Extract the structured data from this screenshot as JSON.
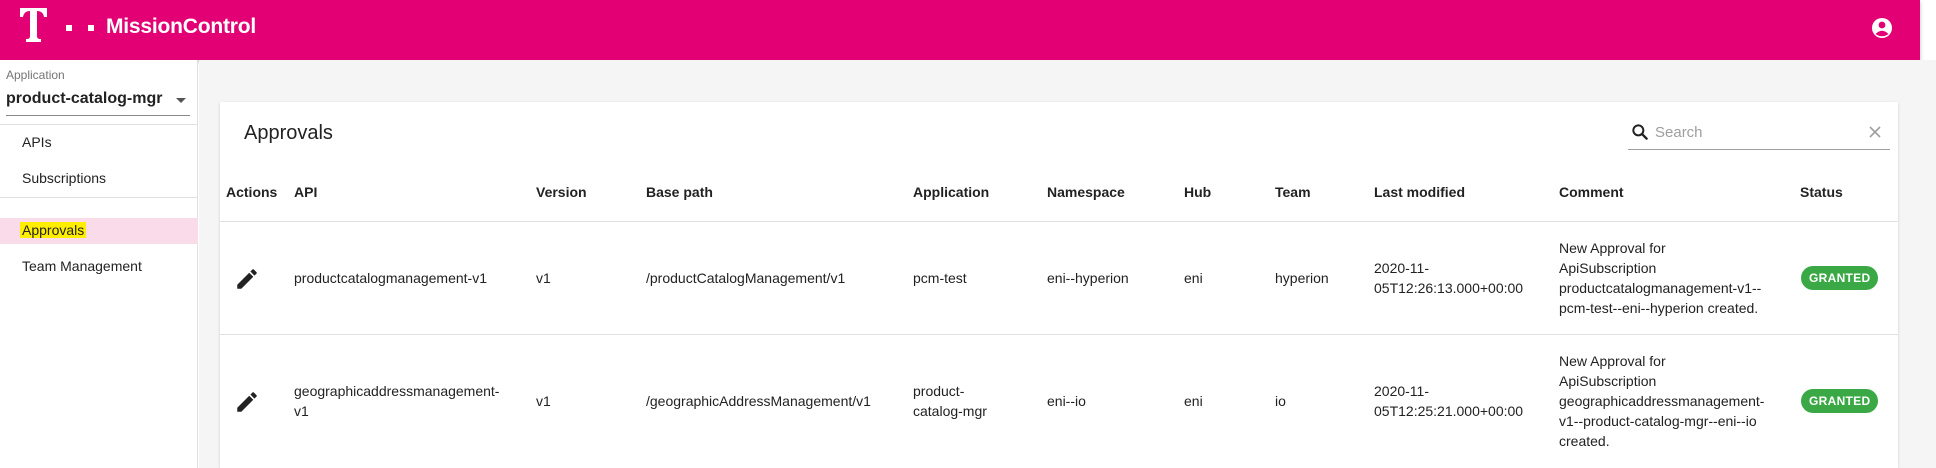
{
  "header": {
    "app_title": "MissionControl",
    "brand_color": "#e20074",
    "logo_icon": "telekom-t-logo",
    "account_icon": "account-circle-icon"
  },
  "sidebar": {
    "application_label": "Application",
    "application_value": "product-catalog-mgr",
    "items": [
      {
        "label": "APIs"
      },
      {
        "label": "Subscriptions"
      },
      {
        "label": "Approvals",
        "active": true
      },
      {
        "label": "Team Management"
      }
    ]
  },
  "approvals": {
    "title": "Approvals",
    "search_placeholder": "Search",
    "columns": {
      "actions": "Actions",
      "api": "API",
      "version": "Version",
      "base_path": "Base path",
      "application": "Application",
      "namespace": "Namespace",
      "hub": "Hub",
      "team": "Team",
      "last_modified": "Last modified",
      "comment": "Comment",
      "status": "Status"
    },
    "rows": [
      {
        "api": [
          "productcatalogmanagement-v1"
        ],
        "version": "v1",
        "base_path": "/productCatalogManagement/v1",
        "application": [
          "pcm-test"
        ],
        "namespace": "eni--hyperion",
        "hub": "eni",
        "team": "hyperion",
        "last_modified": [
          "2020-11-",
          "05T12:26:13.000+00:00"
        ],
        "comment": [
          "New Approval for",
          "ApiSubscription",
          "productcatalogmanagement-v1--",
          "pcm-test--eni--hyperion created."
        ],
        "status": "GRANTED"
      },
      {
        "api": [
          "geographicaddressmanagement-",
          "v1"
        ],
        "version": "v1",
        "base_path": "/geographicAddressManagement/v1",
        "application": [
          "product-",
          "catalog-mgr"
        ],
        "namespace": "eni--io",
        "hub": "eni",
        "team": "io",
        "last_modified": [
          "2020-11-",
          "05T12:25:21.000+00:00"
        ],
        "comment": [
          "New Approval for",
          "ApiSubscription",
          "geographicaddressmanagement-",
          "v1--product-catalog-mgr--eni--io",
          "created."
        ],
        "status": "GRANTED"
      }
    ]
  }
}
